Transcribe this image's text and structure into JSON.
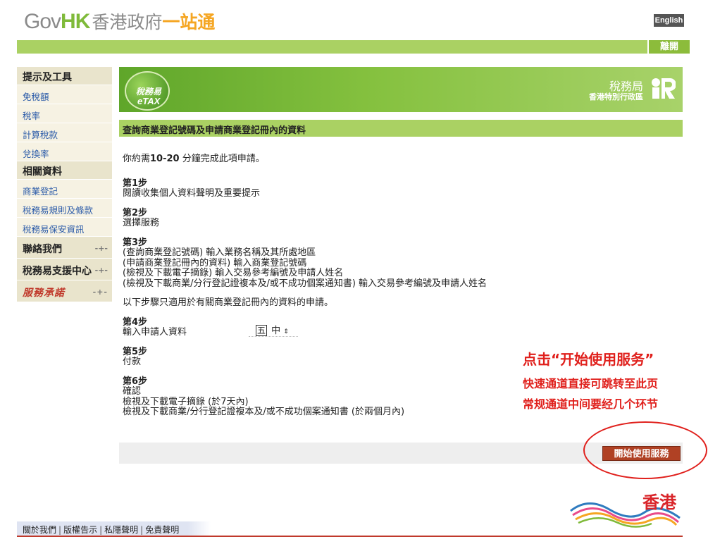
{
  "header": {
    "logo_gov": "Gov",
    "logo_hk": "HK",
    "logo_zh": "香港政府",
    "logo_zh_brand": "一站通",
    "english_label": "English",
    "exit_label": "離開"
  },
  "sidebar": {
    "section1_title": "提示及工具",
    "items1": [
      "免稅額",
      "稅率",
      "計算稅款",
      "兌換率"
    ],
    "section2_title": "相關資料",
    "items2": [
      "商業登記",
      "稅務易規則及條款",
      "稅務易保安資訊"
    ],
    "contact_label": "聯絡我們",
    "support_label": "稅務易支援中心",
    "brand_label": "服務承諾"
  },
  "banner": {
    "etax_zh": "稅務易",
    "etax_en": "eTAX",
    "ird_zh": "稅務局",
    "ird_sub": "香港特別行政區",
    "ird_logo_icon": "ird-logo-icon"
  },
  "page": {
    "title": "查詢商業登記號碼及申請商業登記冊內的資料",
    "intro_pre": "你約需",
    "intro_time": "10-20",
    "intro_post": " 分鐘完成此項申請。",
    "step1_h": "第1步",
    "step1_t": "閱讀收集個人資料聲明及重要提示",
    "step2_h": "第2步",
    "step2_t": "選擇服務",
    "step3_h": "第3步",
    "step3_lines": [
      "(查詢商業登記號碼) 輸入業務名稱及其所處地區",
      "(申請商業登記冊內的資料) 輸入商業登記號碼",
      "(檢視及下載電子摘錄) 輸入交易參考編號及申請人姓名",
      "(檢視及下載商業/分行登記證複本及/或不成功個案通知書) 輸入交易參考編號及申請人姓名"
    ],
    "note": "以下步驟只適用於有關商業登記冊內的資料的申請。",
    "step4_h": "第4步",
    "step4_t": "輸入申請人資料",
    "step5_h": "第5步",
    "step5_t": "付款",
    "step6_h": "第6步",
    "step6_lines": [
      "確認",
      "檢視及下載電子摘錄 (於7天內)",
      "檢視及下載商業/分行登記證複本及/或不成功個案通知書 (於兩個月內)"
    ],
    "start_button": "開始使用服務"
  },
  "ime": {
    "box": "五",
    "label": "中"
  },
  "annotation": {
    "line1": "点击“开始使用服务”",
    "line2": "快速通道直接可跳转至此页",
    "line3": "常规通道中间要经几个环节",
    "color": "#e0201c"
  },
  "brand": {
    "text": "香港"
  },
  "footer": {
    "links": [
      "關於我們",
      "版權告示",
      "私隱聲明",
      "免責聲明"
    ]
  }
}
